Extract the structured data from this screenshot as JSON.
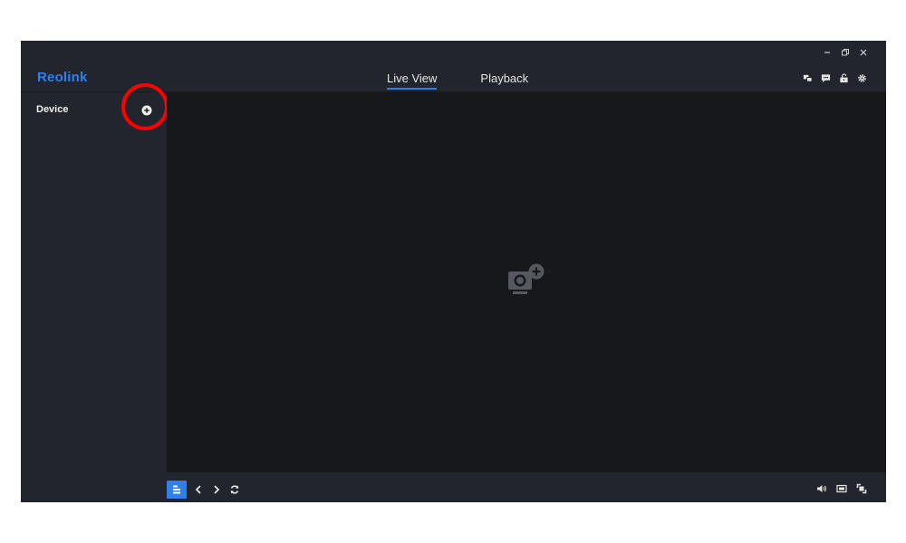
{
  "app": {
    "logo": "Reolink",
    "brand_color": "#2f80ed",
    "window_controls": [
      "minimize-icon",
      "restore-icon",
      "close-icon"
    ]
  },
  "header": {
    "tabs": [
      {
        "label": "Live View",
        "active": true
      },
      {
        "label": "Playback",
        "active": false
      }
    ],
    "icons": [
      "multi-window-icon",
      "message-icon",
      "unlock-icon",
      "gear-icon"
    ]
  },
  "sidebar": {
    "title": "Device",
    "add_icon": "add-circle-icon",
    "highlight_color": "#ff0000"
  },
  "main": {
    "placeholder_icon": "add-camera-icon"
  },
  "bottom_bar": {
    "left_icons": [
      "layout-list-icon",
      "chevron-left-icon",
      "chevron-right-icon",
      "refresh-icon"
    ],
    "right_icons": [
      "volume-icon",
      "screen-icon",
      "fullscreen-icon"
    ]
  }
}
